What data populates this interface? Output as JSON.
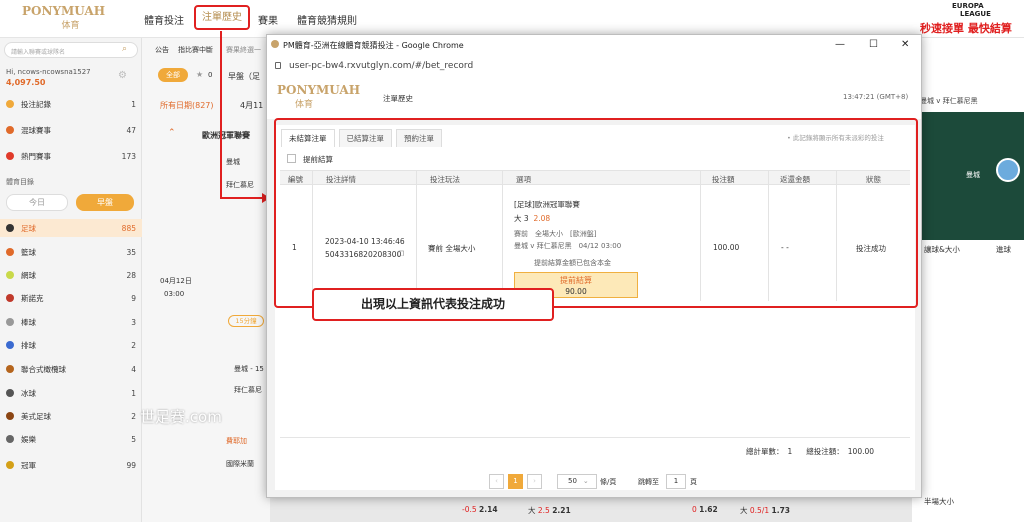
{
  "bg": {
    "logo": {
      "name": "PONYMUAH",
      "sub": "体育"
    },
    "nav": [
      "體育投注",
      "注單歷史",
      "賽果",
      "體育競猜規則"
    ],
    "europa": {
      "line1": "EUROPA",
      "line2": "LEAGUE"
    },
    "banner": "秒速接單 最快結算",
    "search_placeholder": "請輸入聯賽或球隊名",
    "user": {
      "name": "Hi, ncows-ncowsna1527",
      "balance": "4,097.50"
    },
    "side_items": [
      {
        "label": "投注記錄",
        "count": "1",
        "color": "#f0a93a"
      },
      {
        "label": "混球賽事",
        "count": "47",
        "color": "#e06a2a"
      },
      {
        "label": "熱門賽事",
        "count": "173",
        "color": "#e03a2a"
      }
    ],
    "sports_dir": "體育目錄",
    "today": "今日",
    "early": "早盤",
    "sports": [
      {
        "label": "足球",
        "count": "885",
        "color": "#333"
      },
      {
        "label": "籃球",
        "count": "35",
        "color": "#e06a2a"
      },
      {
        "label": "網球",
        "count": "28",
        "color": "#c9d94a"
      },
      {
        "label": "斯諾克",
        "count": "9",
        "color": "#c0392b"
      },
      {
        "label": "棒球",
        "count": "3",
        "color": "#999"
      },
      {
        "label": "排球",
        "count": "2",
        "color": "#3a6ad0"
      },
      {
        "label": "聯合式橄欖球",
        "count": "4",
        "color": "#b5651d"
      },
      {
        "label": "冰球",
        "count": "1",
        "color": "#555"
      },
      {
        "label": "美式足球",
        "count": "2",
        "color": "#8b4513"
      },
      {
        "label": "娛樂",
        "count": "5",
        "color": "#666"
      },
      {
        "label": "冠軍",
        "count": "99",
        "color": "#d4a017"
      }
    ],
    "mid": {
      "tab1": "公告",
      "tab2": "指比賽中斷",
      "tab3": "賽果終選一",
      "all": "全部",
      "star_count": "0",
      "early_label": "早盤（足",
      "date_tab": "所有日期(827)",
      "date2": "4月11",
      "league": "歐洲冠軍聯賽",
      "team1": "曼城",
      "team2": "拜仁慕尼",
      "date": "04月12日",
      "time": "03:00",
      "mins": "15分鐘",
      "t1b": "曼城 - 15",
      "t2b": "拜仁慕尼",
      "team3": "費耶加",
      "team4": "國際米蘭"
    },
    "right": {
      "match": "曼城 v 拜仁慕尼黑",
      "home": "曼城",
      "tab": "讓球&大小",
      "tab2": "進球",
      "ou": "半場大小"
    },
    "watermark": "世足賽.com",
    "bottom_odds": [
      "-0.5",
      "2.14",
      "大",
      "2.5",
      "2.21",
      "0",
      "1.62",
      "大",
      "0.5/1",
      "1.73"
    ]
  },
  "popup": {
    "title": "PM體育-亞洲在線體育競猜投注 - Google Chrome",
    "url": "user-pc-bw4.rxvutglyn.com/#/bet_record",
    "logo": {
      "name": "PONYMUAH",
      "sub": "体育"
    },
    "heading": "注單歷史",
    "clock": "13:47:21 (GMT+8)",
    "tabs": [
      "未結算注單",
      "已結算注單",
      "預約注單"
    ],
    "note": "• 此記錄將顯示所有未派彩的投注",
    "early_settle_label": "提前結算",
    "columns": [
      "編號",
      "投注詳情",
      "投注玩法",
      "選項",
      "投注額",
      "返還金額",
      "狀態"
    ],
    "row": {
      "no": "1",
      "datetime": "2023-04-10 13:46:46",
      "bet_id": "5043316820208300",
      "play": "賽前 全場大小",
      "league": "[足球]歐洲冠軍聯賽",
      "pick": "大 3",
      "odds": "2.08",
      "market": "賽前　全場大小　[歐洲盤]",
      "match": "曼城 v 拜仁慕尼黑　04/12 03:00",
      "settle_note": "提前結算金額已包含本金",
      "cashout_label": "提前結算",
      "cashout_amount": "90.00",
      "stake": "100.00",
      "return": "- -",
      "status": "投注成功"
    },
    "summary": {
      "count_label": "總計單數：",
      "count": "1",
      "total_label": "總投注額：",
      "total": "100.00"
    },
    "pager": {
      "page": "1",
      "per_page": "50",
      "per_page_unit": "條/頁",
      "goto": "跳轉至",
      "goto_page": "1",
      "goto_unit": "頁"
    }
  },
  "annotation": "出現以上資訊代表投注成功"
}
